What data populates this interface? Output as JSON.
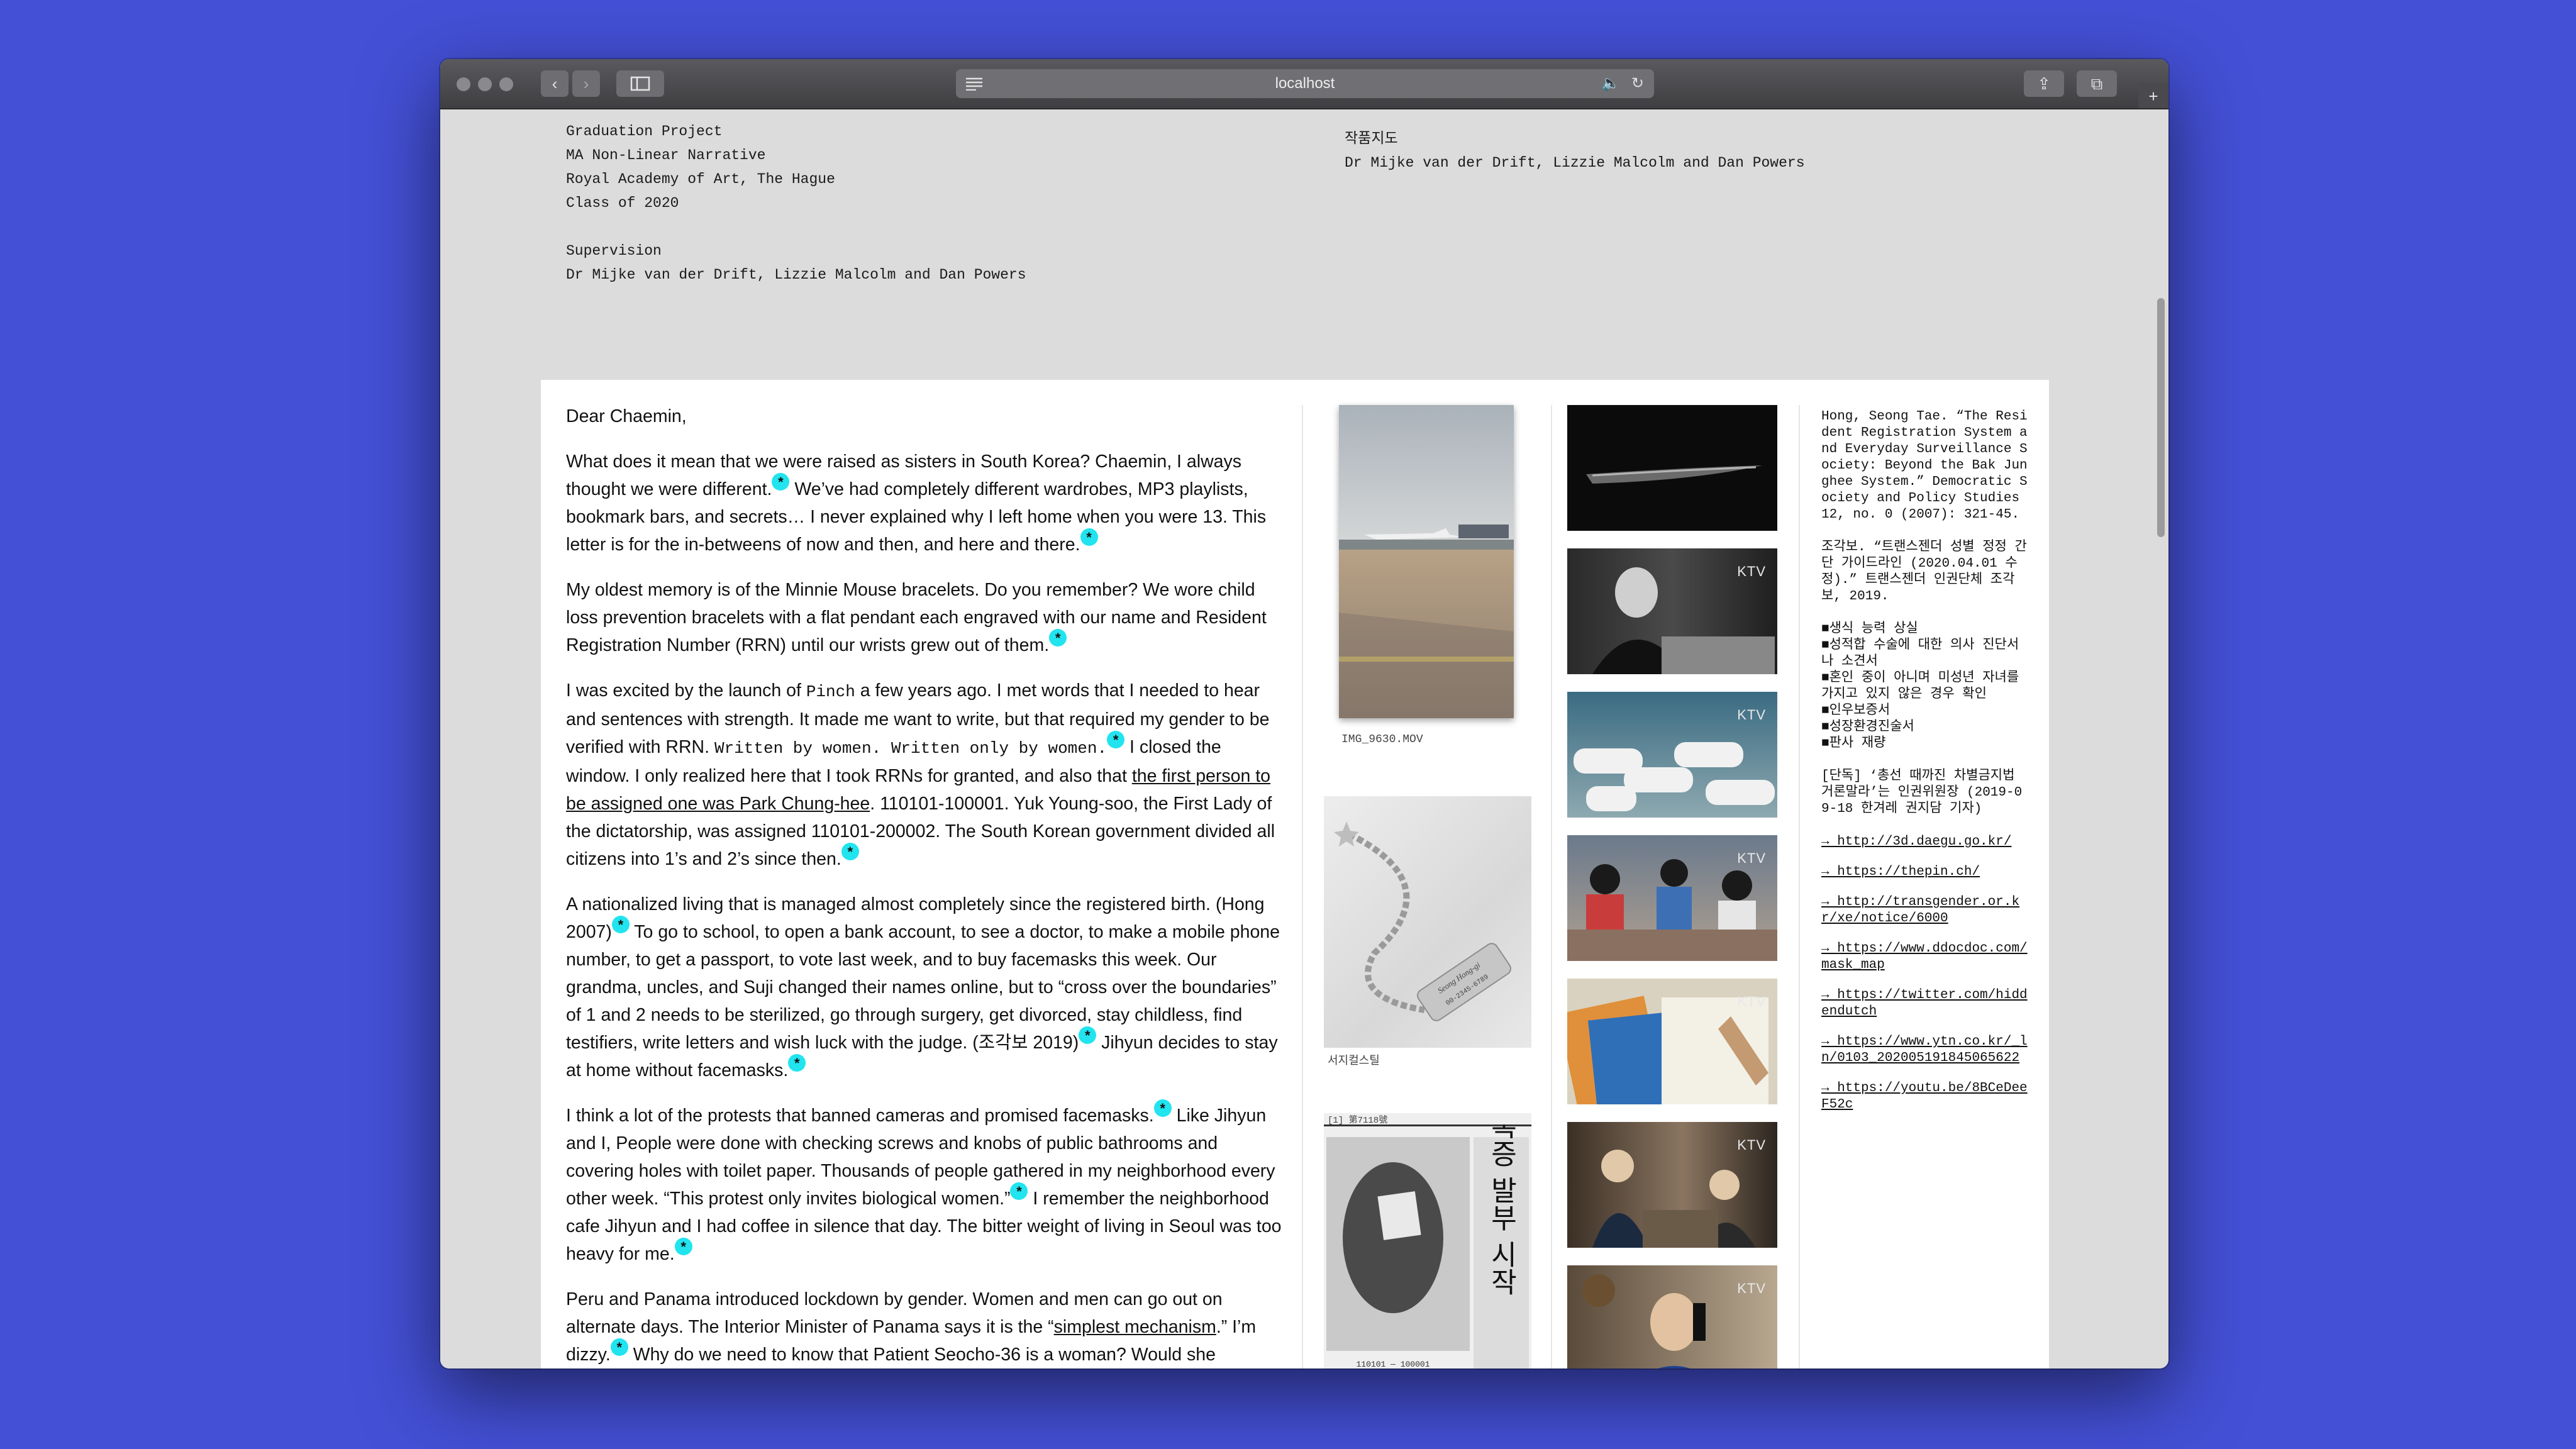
{
  "browser": {
    "url": "localhost",
    "icons": {
      "back": "chevron-left-icon",
      "forward": "chevron-right-icon",
      "sidebar": "sidebar-icon",
      "reader": "reader-icon",
      "audio": "speaker-icon",
      "reload": "reload-icon",
      "share": "share-icon",
      "tabs": "tabs-icon",
      "new_tab": "plus-icon"
    }
  },
  "header": {
    "left_lines": [
      "Graduation Project",
      "MA Non-Linear Narrative",
      "Royal Academy of Art, The Hague",
      "Class of 2020",
      "",
      "Supervision",
      "Dr Mijke van der Drift, Lizzie Malcolm and Dan Powers"
    ],
    "right_title": "작품지도",
    "right_names": "Dr Mijke van der Drift, Lizzie Malcolm and Dan Powers"
  },
  "letter": {
    "salutation": "Dear Chaemin,",
    "footnote_mark": "*",
    "p1_a": "What does it mean that we were raised as sisters in South Korea? Chaemin, I always thought we were different.",
    "p1_b": " We’ve had completely different wardrobes, MP3 playlists, bookmark bars, and secrets… I never explained why I left home when you were 13. This letter is for the in-betweens of now and then, and here and there.",
    "p2": "My oldest memory is of the Minnie Mouse bracelets. Do you remember? We wore child loss prevention bracelets with a flat pendant each engraved with our name and Resident Registration Number (RRN) until our wrists grew out of them.",
    "p3_a": "I was excited by the launch of ",
    "p3_pinch": "Pinch",
    "p3_b": " a few years ago. I met words that I needed to hear and sentences with strength. It made me want to write, but that required my gender to be verified with RRN. ",
    "p3_mono": "Written by women. Written only by women.",
    "p3_c": " I closed the window. I only realized here that I took RRNs for granted, and also that ",
    "p3_link": "the first person to be assigned one was Park Chung-hee",
    "p3_d": ". 110101-100001. Yuk Young-soo, the First Lady of the dictatorship, was assigned 110101-200002. The South Korean government divided all citizens into 1’s and 2’s since then.",
    "p4_a": "A nationalized living that is managed almost completely since the registered birth. (Hong 2007)",
    "p4_b": " To go to school, to open a bank account, to see a doctor, to make a mobile phone number, to get a passport, to vote last week, and to buy facemasks this week. Our grandma, uncles, and Suji changed their names online, but to “cross over the boundaries” of 1 and 2 needs to be sterilized, go through surgery, get divorced, stay childless, find testifiers, write letters and wish luck with the judge. (조각보 2019)",
    "p4_c": " Jihyun decides to stay at home without facemasks.",
    "p5_a": "I think a lot of the protests that banned cameras and promised facemasks.",
    "p5_b": " Like Jihyun and I, People were done with checking screws and knobs of public bathrooms and covering holes with toilet paper. Thousands of people gathered in my neighborhood every other week. “This protest only invites biological women.”",
    "p5_c": " I remember the neighborhood cafe Jihyun and I had coffee in silence that day.  The bitter weight of living in Seoul was too heavy for me.",
    "p6_a": "Peru and Panama introduced lockdown by gender. Women and men can go out on alternate days. The Interior Minister of Panama says it is the “",
    "p6_link": "simplest mechanism",
    "p6_b": ".” I’m dizzy.",
    "p6_c": " Why do we need to know that Patient Seocho-36 is a woman? Would she"
  },
  "media": {
    "video_caption": "IMG_9630.MOV",
    "bracelet_caption": "서지컬스틸",
    "bracelet_text_1": "Seong Hong-gi",
    "bracelet_text_2": "00-2345-6789",
    "newspaper_header": "[1]  第7118號",
    "newspaper_headline": "주민등록증 발부 시작",
    "newspaper_number": "110101 — 100001"
  },
  "ktv_logo": "KTV",
  "references": {
    "ref1": "Hong, Seong Tae. “The Resident Registration System and Everyday Surveillance Society: Beyond the Bak Junghee System.” Democratic Society and Policy Studies 12, no. 0 (2007): 321-45.",
    "ref2": "조각보. “트랜스젠더 성별 정정 간단 가이드라인 (2020.04.01 수정).” 트랜스젠더 인권단체 조각보, 2019.",
    "list": [
      "■생식 능력 상실",
      "■성적합 수술에 대한 의사 진단서나 소견서",
      "■혼인 중이 아니며 미성년 자녀를 가지고 있지 않은 경우 확인",
      "■인우보증서",
      "■성장환경진술서",
      "■판사 재량"
    ],
    "ref3": "[단독] ‘총선 때까진 차별금지법 거론말라’는 인권위원장 (2019-09-18 한겨레 권지담 기자)",
    "links": [
      "→ http://3d.daegu.go.kr/",
      "→ https://thepin.ch/",
      "→ http://transgender.or.kr/xe/notice/6000",
      "→ https://www.ddocdoc.com/mask_map",
      "→ https://twitter.com/hiddendutch",
      "→ https://www.ytn.co.kr/_ln/0103_202005191845065622",
      "→ https://youtu.be/8BCeDeeF52c"
    ]
  }
}
